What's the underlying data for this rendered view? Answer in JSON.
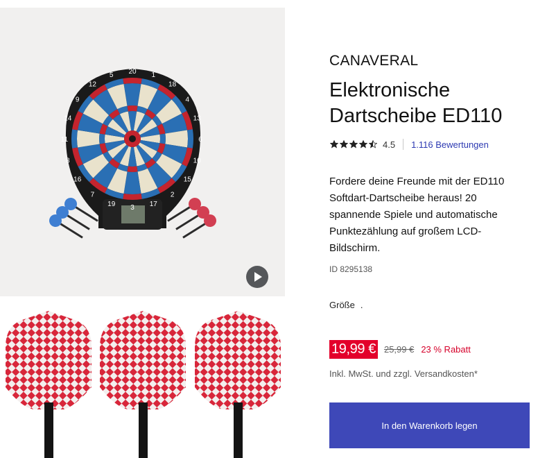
{
  "gallery": {
    "main_image_alt": "",
    "board_numbers": [
      "20",
      "1",
      "18",
      "4",
      "13",
      "6",
      "10",
      "15",
      "2",
      "17",
      "3",
      "19",
      "7",
      "16",
      "8",
      "11",
      "14",
      "9",
      "12",
      "5"
    ],
    "play_icon": "play-icon"
  },
  "product": {
    "brand": "CANAVERAL",
    "title": "Elektronische Dartscheibe ED110",
    "rating": {
      "stars": 4.5,
      "value": "4.5",
      "reviews": "1.116 Bewertungen"
    },
    "description": "Fordere deine Freunde mit der ED110 Softdart-Dartscheibe heraus! 20 spannende Spiele und automatische Punktezählung auf großem LCD-Bildschirm.",
    "id": "ID 8295138",
    "size_label": "Größe",
    "size_value": ".",
    "price": {
      "current": "19,99 €",
      "old": "25,99 €",
      "discount": "23 % Rabatt"
    },
    "tax_note": "Inkl. MwSt. und zzgl. Versandkosten*",
    "cart_button": "In den Warenkorb legen"
  },
  "colors": {
    "accent": "#3e48b8",
    "sale": "#e3002b",
    "link": "#2d3ab2",
    "image_bg": "#f1f0ef"
  }
}
